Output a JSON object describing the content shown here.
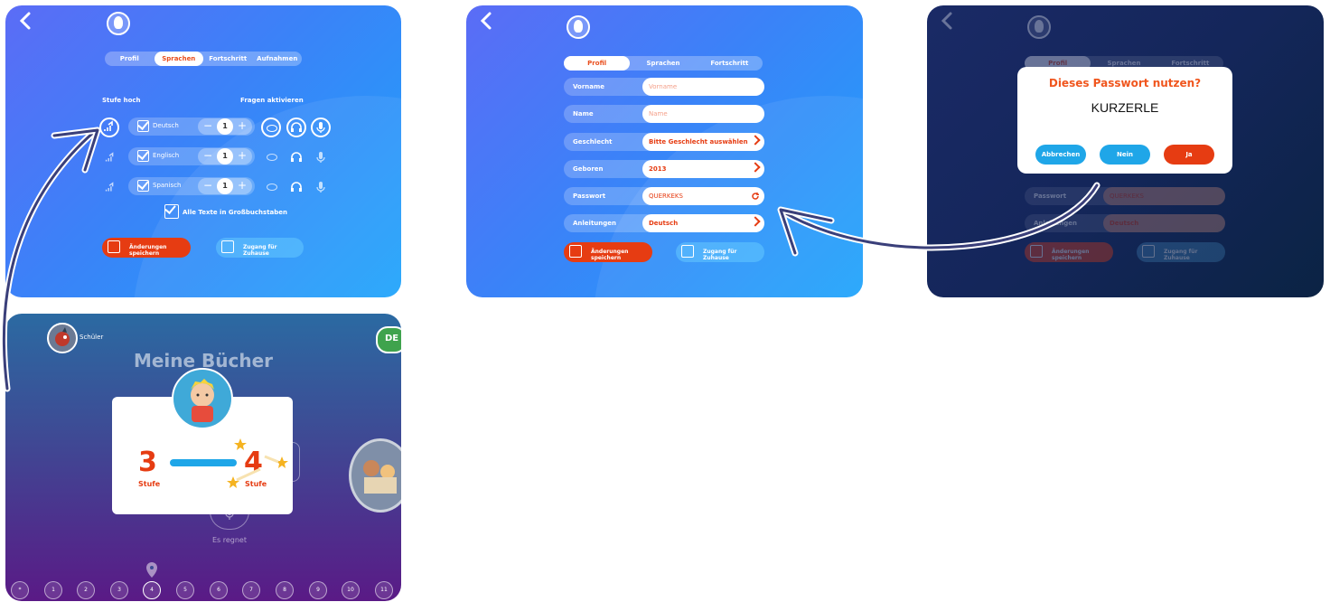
{
  "panel1": {
    "tabs": [
      "Profil",
      "Sprachen",
      "Fortschritt",
      "Aufnahmen"
    ],
    "active_tab": 1,
    "level_up_label": "Stufe hoch",
    "activate_questions_label": "Fragen aktivieren",
    "languages": [
      {
        "name": "Deutsch",
        "level": "1"
      },
      {
        "name": "Englisch",
        "level": "1"
      },
      {
        "name": "Spanisch",
        "level": "1"
      }
    ],
    "uppercase_label": "Alle Texte in Großbuchstaben",
    "save_label": "Änderungen speichern",
    "home_access_label": "Zugang für Zuhause"
  },
  "panel2": {
    "tabs": [
      "Profil",
      "Sprachen",
      "Fortschritt"
    ],
    "active_tab": 0,
    "fields": [
      {
        "label": "Vorname",
        "value": "Vorname",
        "placeholder": true
      },
      {
        "label": "Name",
        "value": "Name",
        "placeholder": true
      },
      {
        "label": "Geschlecht",
        "value": "Bitte Geschlecht auswählen",
        "chevron": true
      },
      {
        "label": "Geboren",
        "value": "2013",
        "chevron": true
      },
      {
        "label": "Passwort",
        "value": "QUERKEKS",
        "refresh": true
      },
      {
        "label": "Anleitungen",
        "value": "Deutsch",
        "chevron": true
      }
    ],
    "save_label": "Änderungen speichern",
    "home_access_label": "Zugang für Zuhause"
  },
  "panel3": {
    "bg_tabs": [
      "Profil",
      "Sprachen",
      "Fortschritt"
    ],
    "bg_password_label": "Passwort",
    "bg_password_value": "QUERKEKS",
    "bg_instructions_label": "Anleitungen",
    "bg_instructions_value": "Deutsch",
    "bg_save_label": "Änderungen speichern",
    "bg_home_label": "Zugang für Zuhause",
    "dialog": {
      "title": "Dieses Passwort nutzen?",
      "password": "KURZERLE",
      "cancel": "Abbrechen",
      "no": "Nein",
      "yes": "Ja"
    }
  },
  "panel4": {
    "user_label": "Schüler",
    "lang_badge": "DE",
    "title": "Meine Bücher",
    "from_level": "3",
    "to_level": "4",
    "level_word": "Stufe",
    "book_caption": "Es regnet",
    "level_dots": [
      "*",
      "1",
      "2",
      "3",
      "4",
      "5",
      "6",
      "7",
      "8",
      "9",
      "10",
      "11"
    ]
  },
  "colors": {
    "accent_red": "#e63c12",
    "accent_blue": "#1fa6e8",
    "orange_title": "#f0561e"
  }
}
